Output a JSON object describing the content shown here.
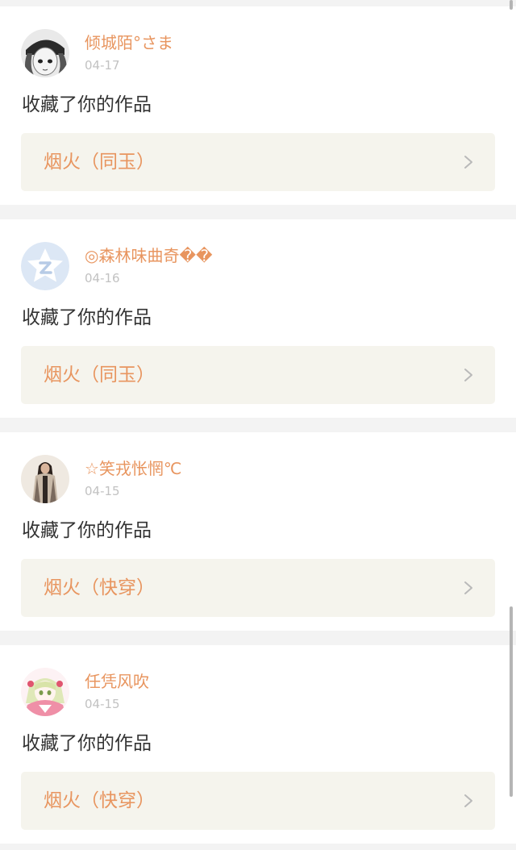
{
  "accent_color": "#e8955f",
  "notifications": [
    {
      "username": "倾城陌°さま",
      "date": "04-17",
      "action": "收藏了你的作品",
      "work_title": "烟火（同玉）",
      "avatar_icon": "avatar-anime-girl-cap-icon"
    },
    {
      "username": "◎森林味曲奇��",
      "date": "04-16",
      "action": "收藏了你的作品",
      "work_title": "烟火（同玉）",
      "avatar_icon": "avatar-default-star-icon"
    },
    {
      "username": "☆笑戎怅惘℃",
      "date": "04-15",
      "action": "收藏了你的作品",
      "work_title": "烟火（快穿）",
      "avatar_icon": "avatar-photo-woman-icon"
    },
    {
      "username": "任凭风吹",
      "date": "04-15",
      "action": "收藏了你的作品",
      "work_title": "烟火（快穿）",
      "avatar_icon": "avatar-anime-pink-girl-icon"
    }
  ]
}
